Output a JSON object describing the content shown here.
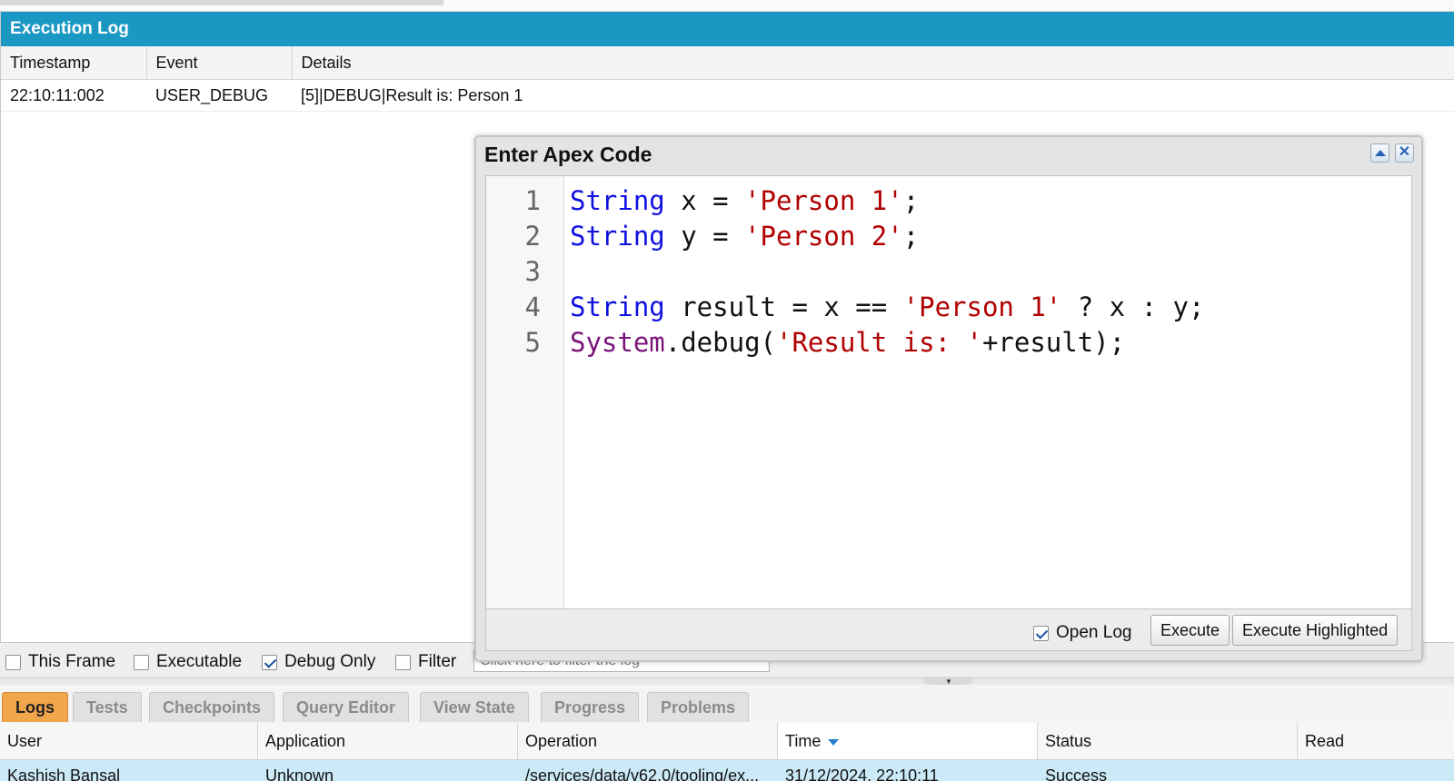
{
  "execution_log": {
    "title": "Execution Log",
    "columns": [
      "Timestamp",
      "Event",
      "Details"
    ],
    "rows": [
      {
        "timestamp": "22:10:11:002",
        "event": "USER_DEBUG",
        "details": "[5]|DEBUG|Result is: Person 1"
      }
    ]
  },
  "filters": {
    "this_frame": {
      "label": "This Frame",
      "checked": false
    },
    "executable": {
      "label": "Executable",
      "checked": false
    },
    "debug_only": {
      "label": "Debug Only",
      "checked": true
    },
    "filter": {
      "label": "Filter",
      "checked": false
    },
    "filter_placeholder": "Click here to filter the log"
  },
  "tabs": [
    "Logs",
    "Tests",
    "Checkpoints",
    "Query Editor",
    "View State",
    "Progress",
    "Problems"
  ],
  "active_tab": "Logs",
  "logs_grid": {
    "columns": [
      "User",
      "Application",
      "Operation",
      "Time",
      "Status",
      "Read"
    ],
    "sort_column": "Time",
    "rows": [
      {
        "user": "Kashish Bansal",
        "application": "Unknown",
        "operation": "/services/data/v62.0/tooling/ex...",
        "time": "31/12/2024, 22:10:11",
        "status": "Success",
        "read": ""
      }
    ]
  },
  "dialog": {
    "title": "Enter Apex Code",
    "line_numbers": [
      "1",
      "2",
      "3",
      "4",
      "5"
    ],
    "code": {
      "l1": {
        "kw": "String",
        "a": " x = ",
        "str": "'Person 1'",
        "b": ";"
      },
      "l2": {
        "kw": "String",
        "a": " y = ",
        "str": "'Person 2'",
        "b": ";"
      },
      "l4": {
        "kw": "String",
        "a": " result = x == ",
        "str": "'Person 1'",
        "b": " ? x : y;"
      },
      "l5": {
        "sys": "System",
        "a": ".debug(",
        "str": "'Result is: '",
        "b": "+result);"
      }
    },
    "open_log": {
      "label": "Open Log",
      "checked": true
    },
    "execute_label": "Execute",
    "execute_highlighted_label": "Execute Highlighted"
  },
  "colors": {
    "header_blue": "#1b97c4",
    "active_tab": "#f1a64c",
    "keyword": "#1010e0",
    "string": "#b00000",
    "system": "#7a147a",
    "selected_row": "#cbe9f6"
  }
}
